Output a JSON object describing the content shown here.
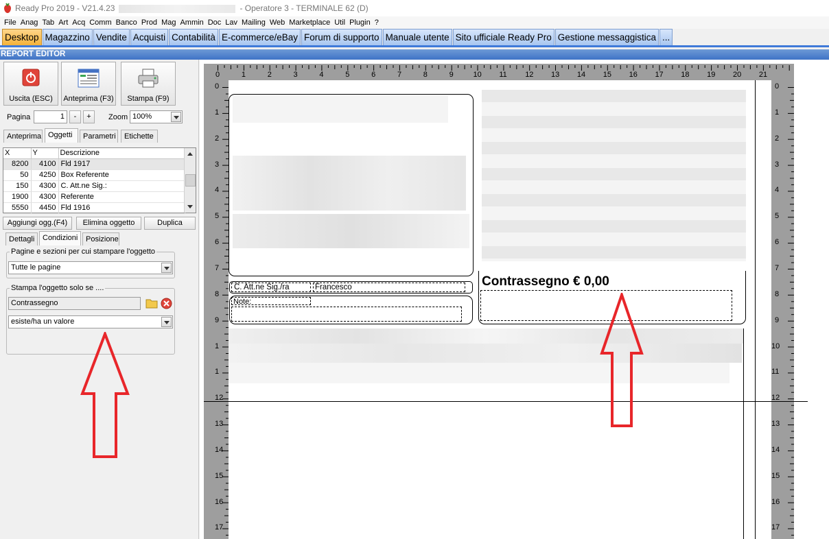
{
  "window": {
    "title_left": "Ready Pro 2019 - V21.4.23",
    "title_right": "- Operatore 3 - TERMINALE 62 (D)"
  },
  "menu": [
    "File",
    "Anag",
    "Tab",
    "Art",
    "Acq",
    "Comm",
    "Banco",
    "Prod",
    "Mag",
    "Ammin",
    "Doc",
    "Lav",
    "Mailing",
    "Web",
    "Marketplace",
    "Util",
    "Plugin",
    "?"
  ],
  "tabs": [
    {
      "label": "Desktop",
      "active": true
    },
    {
      "label": "Magazzino"
    },
    {
      "label": "Vendite"
    },
    {
      "label": "Acquisti"
    },
    {
      "label": "Contabilità"
    },
    {
      "label": "E-commerce/eBay"
    },
    {
      "label": "Forum di supporto"
    },
    {
      "label": "Manuale utente"
    },
    {
      "label": "Sito ufficiale Ready Pro"
    },
    {
      "label": "Gestione messaggistica"
    },
    {
      "label": "..."
    }
  ],
  "editor": {
    "header": "REPORT EDITOR",
    "buttons": {
      "exit": "Uscita (ESC)",
      "preview": "Anteprima (F3)",
      "print": "Stampa (F9)"
    },
    "page_label": "Pagina",
    "page_value": "1",
    "minus": "-",
    "plus": "+",
    "zoom_label": "Zoom",
    "zoom_value": "100%",
    "tabs": [
      "Anteprima",
      "Oggetti",
      "Parametri",
      "Etichette"
    ],
    "grid": {
      "columns": [
        "X",
        "Y",
        "Descrizione"
      ],
      "rows": [
        [
          "8200",
          "4100",
          "Fld 1917"
        ],
        [
          "50",
          "4250",
          "Box Referente"
        ],
        [
          "150",
          "4300",
          "C. Att.ne Sig.:"
        ],
        [
          "1900",
          "4300",
          "Referente"
        ],
        [
          "5550",
          "4450",
          "Fld 1916"
        ]
      ]
    },
    "actions": {
      "add": "Aggiungi ogg.(F4)",
      "delete": "Elimina oggetto",
      "duplicate": "Duplica"
    },
    "subtabs": [
      "Dettagli",
      "Condizioni",
      "Posizione"
    ],
    "pages_group": "Pagine e sezioni per cui stampare l'oggetto",
    "pages_value": "Tutte le pagine",
    "print_group": "Stampa l'oggetto solo se ....",
    "condition_field": "Contrassegno",
    "condition_value": "esiste/ha un valore"
  },
  "ruler": {
    "h": [
      "0",
      "1",
      "2",
      "3",
      "4",
      "5",
      "6",
      "7",
      "8",
      "9",
      "10",
      "11",
      "12",
      "13",
      "14",
      "15",
      "16",
      "17",
      "18",
      "19",
      "20",
      "21"
    ],
    "v": [
      "0",
      "1",
      "2",
      "3",
      "4",
      "5",
      "6",
      "7",
      "8",
      "9",
      "10",
      "11",
      "12",
      "13",
      "14",
      "15",
      "16",
      "17"
    ],
    "vleft_override": {
      "10": "1",
      "11": "1"
    }
  },
  "report": {
    "att_label": "C. Att.ne Sig./ra",
    "att_value": "Francesco",
    "note_label": "Note:",
    "cod_text": "Contrassegno € 0,00"
  },
  "colors": {
    "accent": "#3f7ad9",
    "active_tab": "#f4b23a",
    "arrow": "#e8262a"
  }
}
